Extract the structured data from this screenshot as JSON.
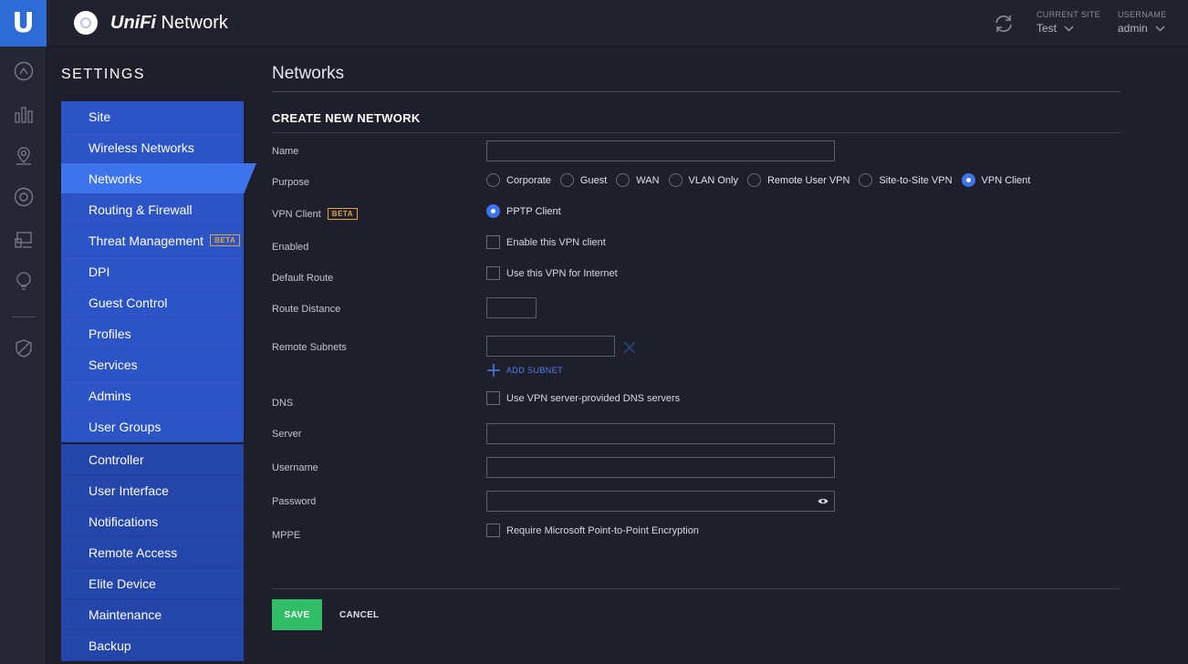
{
  "app": {
    "brand_italic": "UniFi",
    "brand_rest": " Network",
    "logo_letter": "U"
  },
  "header": {
    "current_site_label": "CURRENT SITE",
    "current_site_value": "Test",
    "username_label": "USERNAME",
    "username_value": "admin"
  },
  "rail_icons": [
    "dashboard-icon",
    "statistics-icon",
    "map-icon",
    "devices-icon",
    "clients-icon",
    "insights-icon",
    "shield-icon"
  ],
  "settings": {
    "title": "SETTINGS",
    "group1": [
      {
        "label": "Site"
      },
      {
        "label": "Wireless Networks"
      },
      {
        "label": "Networks"
      },
      {
        "label": "Routing & Firewall"
      },
      {
        "label": "Threat Management",
        "badge": "BETA"
      },
      {
        "label": "DPI"
      },
      {
        "label": "Guest Control"
      },
      {
        "label": "Profiles"
      },
      {
        "label": "Services"
      },
      {
        "label": "Admins"
      },
      {
        "label": "User Groups"
      }
    ],
    "group2": [
      {
        "label": "Controller"
      },
      {
        "label": "User Interface"
      },
      {
        "label": "Notifications"
      },
      {
        "label": "Remote Access"
      },
      {
        "label": "Elite Device"
      },
      {
        "label": "Maintenance"
      },
      {
        "label": "Backup"
      }
    ],
    "active": "Networks"
  },
  "main": {
    "page_title": "Networks",
    "section_title": "CREATE NEW NETWORK",
    "labels": {
      "name": "Name",
      "purpose": "Purpose",
      "vpn_client": "VPN Client",
      "vpn_client_badge": "BETA",
      "enabled": "Enabled",
      "default_route": "Default Route",
      "route_distance": "Route Distance",
      "remote_subnets": "Remote Subnets",
      "dns": "DNS",
      "server": "Server",
      "username": "Username",
      "password": "Password",
      "mppe": "MPPE"
    },
    "purpose_options": [
      "Corporate",
      "Guest",
      "WAN",
      "VLAN Only",
      "Remote User VPN",
      "Site-to-Site VPN",
      "VPN Client"
    ],
    "purpose_selected": "VPN Client",
    "vpn_client_option": "PPTP Client",
    "checks": {
      "enabled": "Enable this VPN client",
      "default_route": "Use this VPN for Internet",
      "dns": "Use VPN server-provided DNS servers",
      "mppe": "Require Microsoft Point-to-Point Encryption"
    },
    "add_subnet": "ADD SUBNET",
    "save": "SAVE",
    "cancel": "CANCEL"
  },
  "colors": {
    "accent": "#3d74ee",
    "nav": "#2c54c6",
    "save": "#2fbd65",
    "beta": "#e0a63a"
  }
}
